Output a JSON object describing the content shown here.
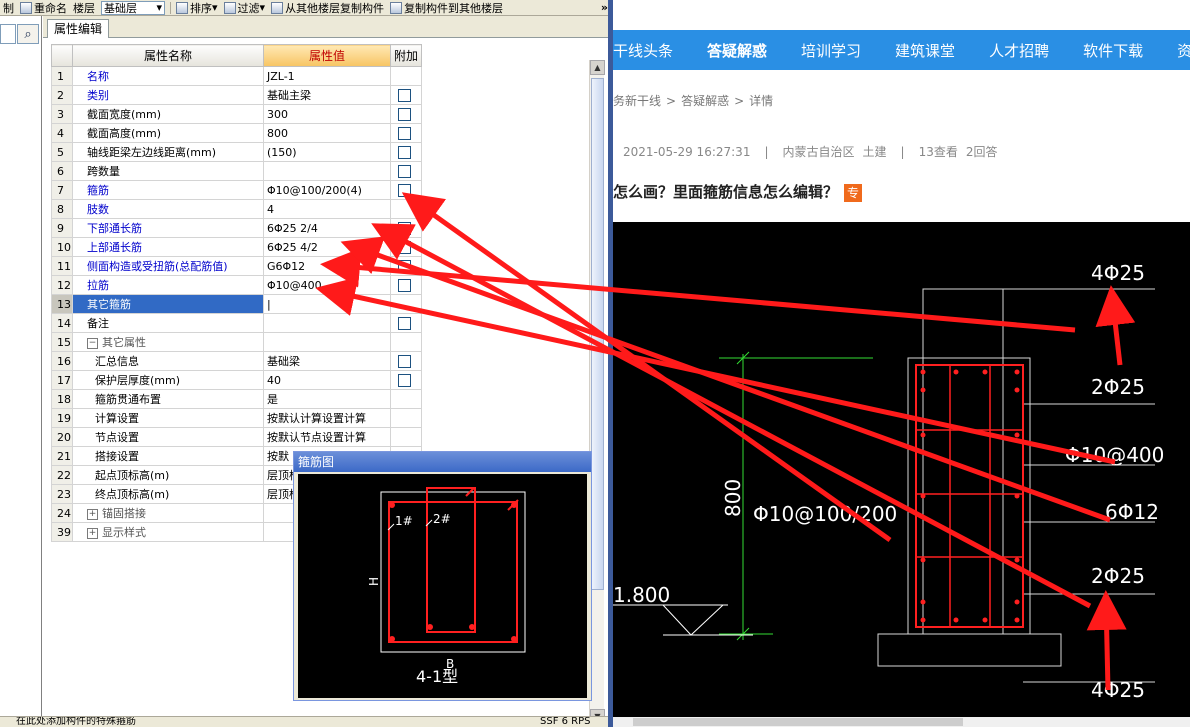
{
  "toolbar": {
    "items": [
      {
        "label": "制",
        "icon": "copy-icon"
      },
      {
        "label": "重命名",
        "icon": "rename-icon"
      },
      {
        "label": "楼层",
        "icon": ""
      },
      {
        "label": "排序",
        "icon": "sort-icon"
      },
      {
        "label": "过滤",
        "icon": "filter-icon"
      },
      {
        "label": "从其他楼层复制构件",
        "icon": "copy-from-floor-icon"
      },
      {
        "label": "复制构件到其他楼层",
        "icon": "copy-to-floor-icon"
      }
    ],
    "floor_value": "基础层",
    "more": "»"
  },
  "panel": {
    "tab": "属性编辑",
    "headers": {
      "name": "属性名称",
      "value": "属性值",
      "extra": "附加"
    }
  },
  "rows": [
    {
      "no": "1",
      "name": "名称",
      "value": "JZL-1",
      "blue": true,
      "cb": false
    },
    {
      "no": "2",
      "name": "类别",
      "value": "基础主梁",
      "blue": true,
      "cb": true
    },
    {
      "no": "3",
      "name": "截面宽度(mm)",
      "value": "300",
      "blue": false,
      "cb": true
    },
    {
      "no": "4",
      "name": "截面高度(mm)",
      "value": "800",
      "blue": false,
      "cb": true
    },
    {
      "no": "5",
      "name": "轴线距梁左边线距离(mm)",
      "value": "(150)",
      "blue": false,
      "cb": true
    },
    {
      "no": "6",
      "name": "跨数量",
      "value": "",
      "blue": false,
      "cb": true
    },
    {
      "no": "7",
      "name": "箍筋",
      "value": "Φ10@100/200(4)",
      "blue": true,
      "cb": true
    },
    {
      "no": "8",
      "name": "肢数",
      "value": "4",
      "blue": true,
      "cb": false
    },
    {
      "no": "9",
      "name": "下部通长筋",
      "value": "6Φ25 2/4",
      "blue": true,
      "cb": true
    },
    {
      "no": "10",
      "name": "上部通长筋",
      "value": "6Φ25 4/2",
      "blue": true,
      "cb": true
    },
    {
      "no": "11",
      "name": "侧面构造或受扭筋(总配筋值)",
      "value": "G6Φ12",
      "blue": true,
      "cb": true
    },
    {
      "no": "12",
      "name": "拉筋",
      "value": "Φ10@400",
      "blue": true,
      "cb": true
    },
    {
      "no": "13",
      "name": "其它箍筋",
      "value": "|",
      "blue": false,
      "cb": false,
      "selected": true
    },
    {
      "no": "14",
      "name": "备注",
      "value": "",
      "blue": false,
      "cb": true
    },
    {
      "no": "15",
      "name": "其它属性",
      "value": "",
      "blue": false,
      "cb": false,
      "group": "−"
    },
    {
      "no": "16",
      "name": "汇总信息",
      "value": "基础梁",
      "blue": false,
      "cb": true,
      "indent": true
    },
    {
      "no": "17",
      "name": "保护层厚度(mm)",
      "value": "40",
      "blue": false,
      "cb": true,
      "indent": true
    },
    {
      "no": "18",
      "name": "箍筋贯通布置",
      "value": "是",
      "blue": false,
      "cb": false,
      "indent": true
    },
    {
      "no": "19",
      "name": "计算设置",
      "value": "按默认计算设置计算",
      "blue": false,
      "cb": false,
      "indent": true
    },
    {
      "no": "20",
      "name": "节点设置",
      "value": "按默认节点设置计算",
      "blue": false,
      "cb": false,
      "indent": true
    },
    {
      "no": "21",
      "name": "搭接设置",
      "value": "按默",
      "blue": false,
      "cb": false,
      "indent": true
    },
    {
      "no": "22",
      "name": "起点顶标高(m)",
      "value": "层顶标",
      "blue": false,
      "cb": false,
      "indent": true
    },
    {
      "no": "23",
      "name": "终点顶标高(m)",
      "value": "层顶标",
      "blue": false,
      "cb": false,
      "indent": true
    },
    {
      "no": "24",
      "name": "锚固搭接",
      "value": "",
      "blue": false,
      "cb": false,
      "group": "+"
    },
    {
      "no": "39",
      "name": "显示样式",
      "value": "",
      "blue": false,
      "cb": false,
      "group": "+"
    }
  ],
  "popup": {
    "title": "箍筋图",
    "label_1": "1#",
    "label_2": "2#",
    "label_h": "H",
    "label_b": "B",
    "type_label": "4-1型"
  },
  "statusbar": {
    "left": "在此处添加构件的特殊箍筋",
    "right": "SSF 6 RPS"
  },
  "web": {
    "nav": [
      "干线头条",
      "答疑解惑",
      "培训学习",
      "建筑课堂",
      "人才招聘",
      "软件下载",
      "资"
    ],
    "active_nav": "答疑解惑",
    "breadcrumb": [
      "务新干线",
      "答疑解惑",
      "详情"
    ],
    "crumb_sep": ">",
    "meta": {
      "date": "2021-05-29 16:27:31",
      "region": "内蒙古自治区",
      "category": "土建",
      "views": "13查看",
      "answers": "2回答",
      "separator": "|"
    },
    "question": "怎么画？里面箍筋信息怎么编辑？",
    "badge": "专"
  },
  "cad": {
    "top_label": "4Φ25",
    "label_2": "2Φ25",
    "label_tie": "Φ10@400",
    "label_side": "6Φ12",
    "label_3": "2Φ25",
    "bottom_label": "4Φ25",
    "height": "800",
    "stirrup": "Φ10@100/200",
    "elevation": "1.800"
  },
  "colors": {
    "annotation_red": "#ff1a1a",
    "rebar_red": "#ff2020",
    "nav_blue": "#2a8fe4",
    "selection_blue": "#316ac5"
  }
}
